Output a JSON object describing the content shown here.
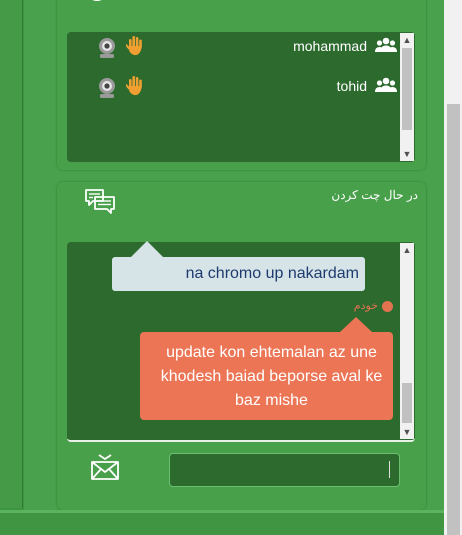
{
  "users": [
    {
      "name": "mohammad"
    },
    {
      "name": "tohid"
    }
  ],
  "chat": {
    "title": "در حال چت کردن",
    "incoming_message": "na chromo up nakardam",
    "sender_label": "خودم",
    "outgoing_message": "update kon ehtemalan az une khodesh baiad beporse aval ke baz mishe",
    "input_value": ""
  },
  "icons": {
    "webcam": "webcam-icon",
    "hand": "raise-hand-icon",
    "group": "group-users-icon",
    "chat": "chat-bubbles-icon",
    "send": "send-envelope-icon"
  },
  "colors": {
    "background": "#4aa14d",
    "panel_dark": "#2c6a2e",
    "incoming_bubble": "#d6e4e8",
    "outgoing_bubble": "#ec7555",
    "hand": "#f0a030"
  }
}
